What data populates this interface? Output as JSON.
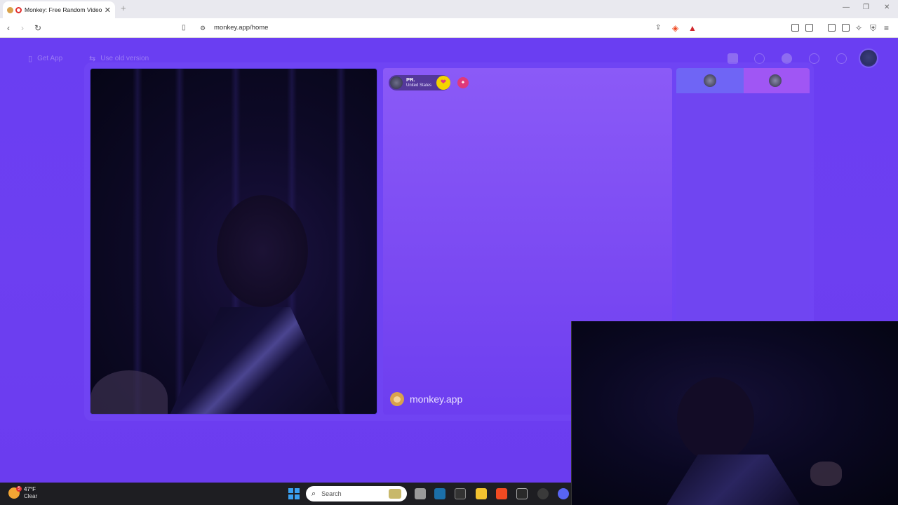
{
  "browser": {
    "tab_title": "Monkey: Free Random Video",
    "url": "monkey.app/home"
  },
  "page": {
    "get_app": "Get App",
    "use_old_version": "Use old version"
  },
  "chat": {
    "partner_name": "PR.",
    "partner_location": "United States",
    "brand": "monkey.app"
  },
  "taskbar": {
    "weather_temp": "47°F",
    "weather_desc": "Clear",
    "weather_badge": "5",
    "search_placeholder": "Search"
  },
  "colors": {
    "page_bg": "#6b3df0",
    "chat_panel": "#8b5af7",
    "heart_button": "#f3d400",
    "gift_button": "#e0397a"
  },
  "icons": {
    "tab": [
      "monkey-favicon",
      "recording-icon",
      "close-icon"
    ],
    "nav": [
      "back-icon",
      "forward-icon",
      "reload-icon",
      "bookmark-icon",
      "site-info-icon",
      "share-icon",
      "brave-shields-icon",
      "brave-rewards-icon",
      "extensions-icon",
      "sidebar-icon",
      "wallet-icon",
      "leo-ai-icon",
      "vpn-icon",
      "menu-icon"
    ],
    "page_top": [
      "phone-icon",
      "swap-icon",
      "shop-icon",
      "search-icon",
      "coins-icon",
      "history-icon",
      "chat-icon",
      "avatar"
    ],
    "taskbar": [
      "windows-start-icon",
      "task-view-icon",
      "steam-icon",
      "app-icon",
      "file-explorer-icon",
      "brave-icon",
      "epic-games-icon",
      "obs-icon",
      "discord-icon"
    ]
  }
}
